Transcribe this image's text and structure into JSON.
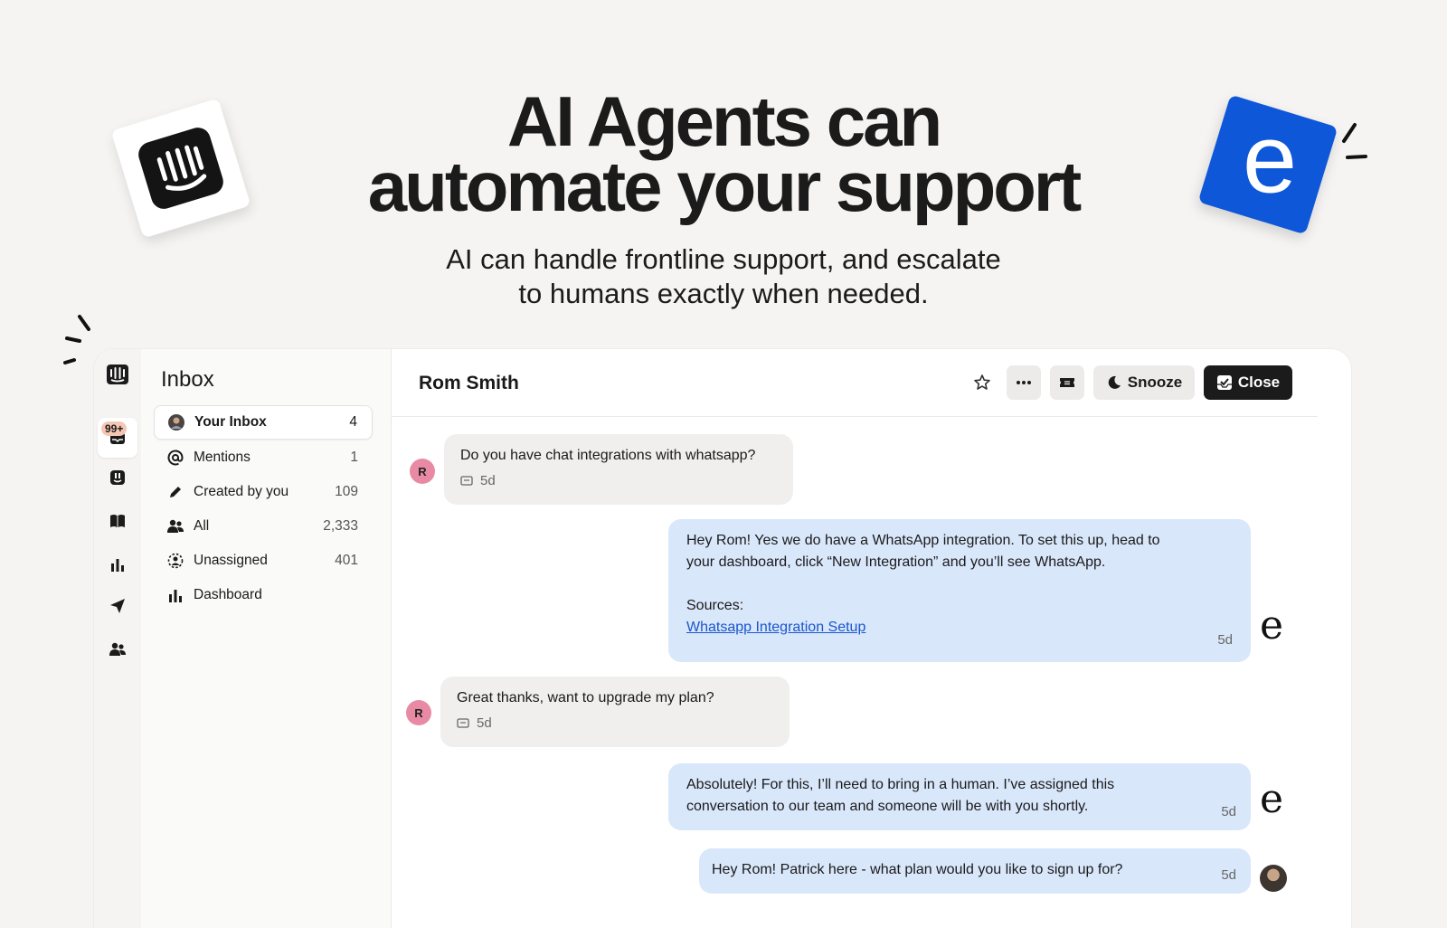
{
  "hero": {
    "title_line1": "AI Agents can",
    "title_line2": "automate your support",
    "subtitle_line1": "AI can handle frontline support, and escalate",
    "subtitle_line2": "to humans exactly when needed."
  },
  "brand": {
    "ai_logo_letter": "e",
    "ai_logo_color": "#0d57d8",
    "intercom_logo_icon": "intercom-logo-icon"
  },
  "rail": {
    "badge": "99+",
    "icons": [
      "intercom-logo-icon",
      "inbox-icon",
      "fin-bot-icon",
      "book-icon",
      "chart-icon",
      "send-icon",
      "people-icon"
    ]
  },
  "sidebar": {
    "title": "Inbox",
    "items": [
      {
        "label": "Your Inbox",
        "count": "4",
        "icon": "avatar-icon"
      },
      {
        "label": "Mentions",
        "count": "1",
        "icon": "at-icon"
      },
      {
        "label": "Created by you",
        "count": "109",
        "icon": "pencil-icon"
      },
      {
        "label": "All",
        "count": "2,333",
        "icon": "people-icon"
      },
      {
        "label": "Unassigned",
        "count": "401",
        "icon": "unassigned-icon"
      },
      {
        "label": "Dashboard",
        "count": "",
        "icon": "chart-icon"
      }
    ]
  },
  "conversation": {
    "name": "Rom Smith",
    "buttons": {
      "snooze": "Snooze",
      "close": "Close"
    },
    "messages": [
      {
        "from": "user",
        "avatar": "R",
        "text": "Do you have chat integrations with whatsapp?",
        "time": "5d"
      },
      {
        "from": "bot",
        "line1": "Hey Rom! Yes we do have a WhatsApp integration. To set this up, head to",
        "line2": "your dashboard, click “New Integration” and you’ll see WhatsApp.",
        "sources_label": "Sources:",
        "link": "Whatsapp Integration Setup",
        "time": "5d"
      },
      {
        "from": "user",
        "avatar": "R",
        "text": "Great thanks, want to upgrade my plan?",
        "time": "5d"
      },
      {
        "from": "bot",
        "line1": "Absolutely! For this, I’ll need to bring in a human. I’ve assigned this",
        "line2": "conversation to our team and someone will be with you shortly.",
        "time": "5d"
      },
      {
        "from": "human",
        "text": "Hey Rom! Patrick here - what plan would you like to sign up for?",
        "time": "5d"
      }
    ]
  },
  "colors": {
    "background": "#f5f4f2",
    "bot_bubble": "#d9e7fb",
    "user_bubble": "#f0efed",
    "avatar_r": "#e88aa3",
    "badge": "#f5c6b4",
    "close_button": "#1b1b1b"
  }
}
